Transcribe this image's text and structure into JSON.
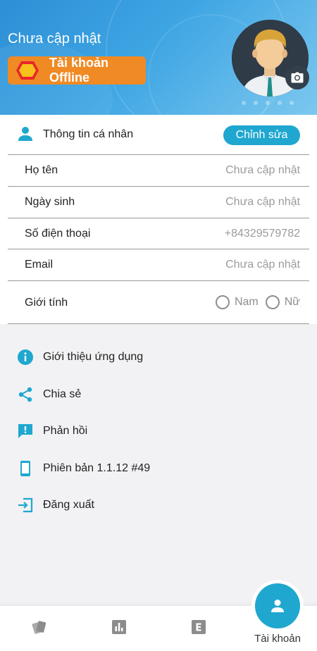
{
  "header": {
    "name": "Chưa cập nhật",
    "account_badge": "Tài khoản Offline"
  },
  "personal_info": {
    "title": "Thông tin cá nhân",
    "edit_label": "Chỉnh sửa",
    "fields": [
      {
        "label": "Họ tên",
        "value": "Chưa cập nhật"
      },
      {
        "label": "Ngày sinh",
        "value": "Chưa cập nhật"
      },
      {
        "label": "Số điện thoại",
        "value": "+84329579782"
      },
      {
        "label": "Email",
        "value": "Chưa cập nhật"
      }
    ],
    "gender": {
      "label": "Giới tính",
      "options": [
        "Nam",
        "Nữ"
      ]
    }
  },
  "menu": [
    {
      "label": "Giới thiệu ứng dụng",
      "icon": "info-icon"
    },
    {
      "label": "Chia sẻ",
      "icon": "share-icon"
    },
    {
      "label": "Phản hồi",
      "icon": "feedback-icon"
    },
    {
      "label": "Phiên bản 1.1.12 #49",
      "icon": "phone-icon"
    },
    {
      "label": "Đăng xuất",
      "icon": "logout-icon"
    }
  ],
  "bottom_nav": {
    "items": [
      {
        "icon": "cards-icon"
      },
      {
        "icon": "chart-icon"
      },
      {
        "icon": "e-letter-icon"
      }
    ],
    "active": {
      "icon": "person-icon",
      "label": "Tài khoản"
    }
  },
  "colors": {
    "accent": "#1fa7cf",
    "badge": "#f08a24",
    "header_start": "#2d8fd6",
    "header_end": "#7cc8ef"
  }
}
